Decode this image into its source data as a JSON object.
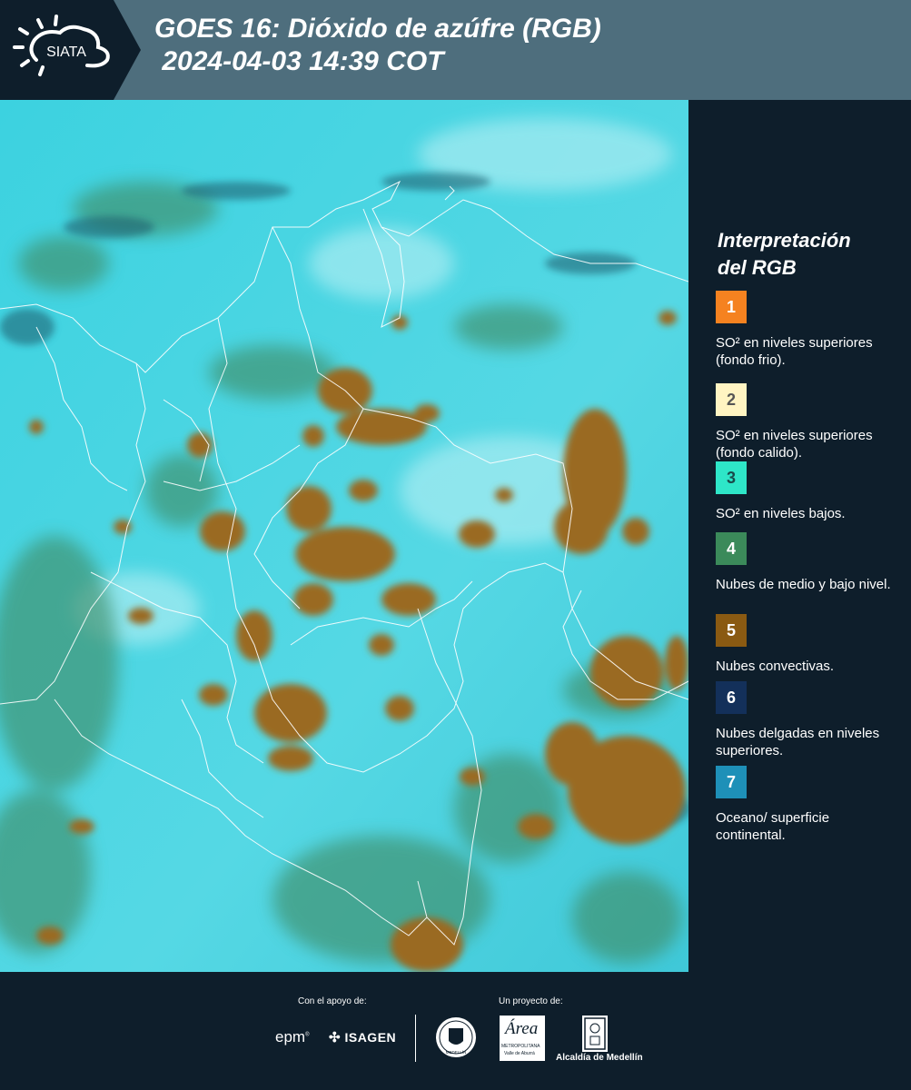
{
  "header": {
    "logo_text": "SIATA",
    "title_line1": "GOES 16: Dióxido de azúfre (RGB)",
    "title_line2": " 2024-04-03 14:39 COT"
  },
  "legend": {
    "title_line1": "Interpretación",
    "title_line2": "del RGB",
    "items": [
      {
        "num": "1",
        "color": "#f58220",
        "num_color": "#ffffff",
        "text": "SO² en niveles superiores (fondo frio)."
      },
      {
        "num": "2",
        "color": "#fff4c2",
        "num_color": "#555555",
        "text": "SO² en niveles superiores (fondo calido)."
      },
      {
        "num": "3",
        "color": "#2ee6c8",
        "num_color": "#1a4a4a",
        "text": "SO² en niveles bajos."
      },
      {
        "num": "4",
        "color": "#3b8a5a",
        "num_color": "#ffffff",
        "text": "Nubes de medio y bajo nivel."
      },
      {
        "num": "5",
        "color": "#8a5a12",
        "num_color": "#ffffff",
        "text": "Nubes convectivas."
      },
      {
        "num": "6",
        "color": "#13305a",
        "num_color": "#ffffff",
        "text": "Nubes delgadas en niveles superiores."
      },
      {
        "num": "7",
        "color": "#1e90b8",
        "num_color": "#ffffff",
        "text": "Oceano/ superficie continental."
      }
    ]
  },
  "footer": {
    "support_label": "Con el apoyo de:",
    "project_label": "Un proyecto de:",
    "epm": "epm",
    "isagen": "ISAGEN",
    "area_name": "Área",
    "area_sub1": "METROPOLITANA",
    "area_sub2": "Valle de Aburrá",
    "alcaldia": "Alcaldía de Medellín",
    "seal_text": "MEDELLÍN"
  },
  "colors": {
    "header_bg": "#4e6e7d",
    "page_bg": "#0e1e2b",
    "map_cyan": "#3fd0e0",
    "cloud_brown": "#9a6a24"
  }
}
